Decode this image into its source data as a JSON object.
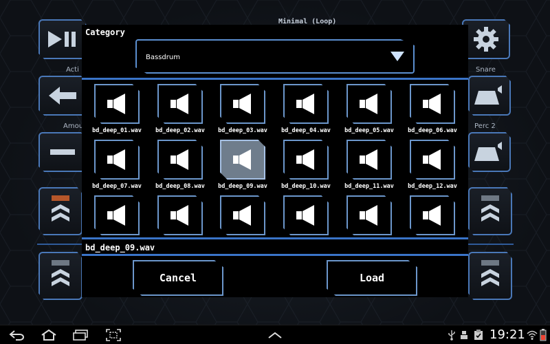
{
  "background_app": {
    "title": "Minimal (Loop)",
    "labels": {
      "active": "Acti",
      "amount": "Amou",
      "snare": "Snare",
      "perc2": "Perc 2"
    }
  },
  "dialog": {
    "title": "Category",
    "category_selected": "Bassdrum",
    "selected_file": "bd_deep_09.wav",
    "cancel_label": "Cancel",
    "load_label": "Load",
    "files": [
      {
        "name": "bd_deep_01.wav",
        "selected": false
      },
      {
        "name": "bd_deep_02.wav",
        "selected": false
      },
      {
        "name": "bd_deep_03.wav",
        "selected": false
      },
      {
        "name": "bd_deep_04.wav",
        "selected": false
      },
      {
        "name": "bd_deep_05.wav",
        "selected": false
      },
      {
        "name": "bd_deep_06.wav",
        "selected": false
      },
      {
        "name": "bd_deep_07.wav",
        "selected": false
      },
      {
        "name": "bd_deep_08.wav",
        "selected": false
      },
      {
        "name": "bd_deep_09.wav",
        "selected": true
      },
      {
        "name": "bd_deep_10.wav",
        "selected": false
      },
      {
        "name": "bd_deep_11.wav",
        "selected": false
      },
      {
        "name": "bd_deep_12.wav",
        "selected": false
      },
      {
        "name": "",
        "selected": false
      },
      {
        "name": "",
        "selected": false
      },
      {
        "name": "",
        "selected": false
      },
      {
        "name": "",
        "selected": false
      },
      {
        "name": "",
        "selected": false
      },
      {
        "name": "",
        "selected": false
      }
    ]
  },
  "statusbar": {
    "time": "19:21",
    "icons": [
      "back-icon",
      "home-icon",
      "recent-apps-icon",
      "screenshot-icon",
      "up-chevron-icon",
      "usb-icon",
      "debug-icon",
      "clipboard-icon",
      "wifi-icon",
      "battery-icon"
    ]
  },
  "colors": {
    "accent_blue": "#5b8fd0",
    "selected_tile": "#6f7d8c",
    "dialog_bg": "#000000"
  }
}
